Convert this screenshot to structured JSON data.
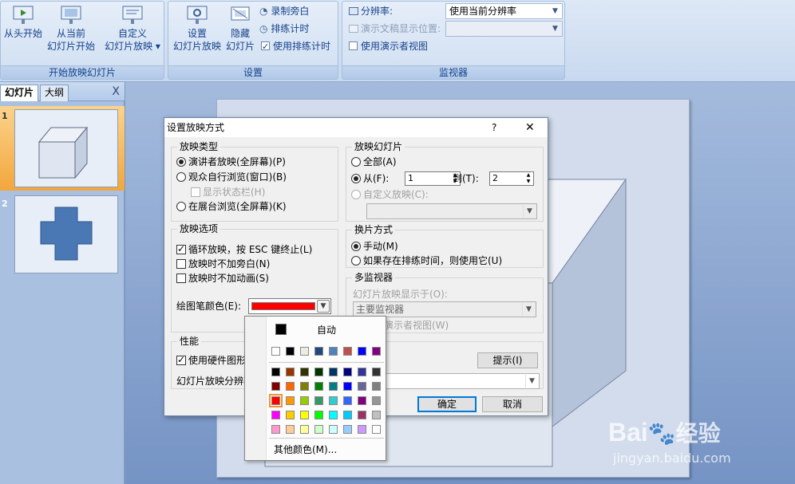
{
  "ribbon": {
    "groups": {
      "start": {
        "label": "开始放映幻灯片",
        "from_beginning": [
          "从头开始"
        ],
        "from_current_l1": "从当前",
        "from_current_l2": "幻灯片开始",
        "custom_l1": "自定义",
        "custom_l2": "幻灯片放映 ▾"
      },
      "setup": {
        "label": "设置",
        "setup_show_l1": "设置",
        "setup_show_l2": "幻灯片放映",
        "hide_l1": "隐藏",
        "hide_l2": "幻灯片",
        "record_narration": "录制旁白",
        "rehearse_timings": "排练计时",
        "use_rehearsed_timings": "使用排练计时"
      },
      "monitors": {
        "label": "监视器",
        "resolution_label": "分辨率:",
        "resolution_value": "使用当前分辨率",
        "show_on_label": "演示文稿显示位置:",
        "presenter_view": "使用演示者视图"
      }
    }
  },
  "left_panel": {
    "tab_slides": "幻灯片",
    "tab_outline": "大纲",
    "close": "X",
    "slides": [
      {
        "num": "1"
      },
      {
        "num": "2"
      }
    ]
  },
  "dialog": {
    "title": "设置放映方式",
    "help": "?",
    "close": "✕",
    "show_type": {
      "legend": "放映类型",
      "presenter": "演讲者放映(全屏幕)(P)",
      "individual": "观众自行浏览(窗口)(B)",
      "status_bar": "显示状态栏(H)",
      "kiosk": "在展台浏览(全屏幕)(K)"
    },
    "show_slides": {
      "legend": "放映幻灯片",
      "all": "全部(A)",
      "from": "从(F):",
      "from_value": "1",
      "to": "到(T):",
      "to_value": "2",
      "custom": "自定义放映(C):"
    },
    "show_options": {
      "legend": "放映选项",
      "loop": "循环放映，按 ESC 键终止(L)",
      "no_narration": "放映时不加旁白(N)",
      "no_animation": "放映时不加动画(S)",
      "pen_color": "绘图笔颜色(E):",
      "pen_color_value": "#ff0000"
    },
    "advance": {
      "legend": "换片方式",
      "manual": "手动(M)",
      "timings": "如果存在排练时间，则使用它(U)"
    },
    "multi_monitor": {
      "legend": "多监视器",
      "display_on": "幻灯片放映显示于(O):",
      "display_value": "主要监视器",
      "presenter_view": "显示演示者视图(W)"
    },
    "performance": {
      "legend": "性能",
      "hardware": "使用硬件图形加速(G)",
      "resolution": "幻灯片放映分辨率(R):",
      "tips": "提示(I)"
    },
    "ok": "确定",
    "cancel": "取消"
  },
  "color_popup": {
    "auto": "自动",
    "more": "其他颜色(M)...",
    "auto_color": "#000000",
    "theme_row": [
      "#ffffff",
      "#000000",
      "#eeece1",
      "#1f497d",
      "#4f81bd",
      "#c0504d",
      "#0000ff",
      "#800080"
    ],
    "grid": [
      [
        "#000000",
        "#993300",
        "#333300",
        "#003300",
        "#003366",
        "#000080",
        "#333399",
        "#333333"
      ],
      [
        "#800000",
        "#ff6600",
        "#808000",
        "#008000",
        "#008080",
        "#0000ff",
        "#666699",
        "#808080"
      ],
      [
        "#ff0000",
        "#ff9900",
        "#99cc00",
        "#339966",
        "#33cccc",
        "#3366ff",
        "#800080",
        "#969696"
      ],
      [
        "#ff00ff",
        "#ffcc00",
        "#ffff00",
        "#00ff00",
        "#00ffff",
        "#00ccff",
        "#993366",
        "#c0c0c0"
      ],
      [
        "#ff99cc",
        "#ffcc99",
        "#ffff99",
        "#ccffcc",
        "#ccffff",
        "#99ccff",
        "#cc99ff",
        "#ffffff"
      ]
    ],
    "selected": "#ff0000"
  },
  "watermark": {
    "brand": "Bai",
    "brand2": "经验",
    "url": "jingyan.baidu.com"
  }
}
